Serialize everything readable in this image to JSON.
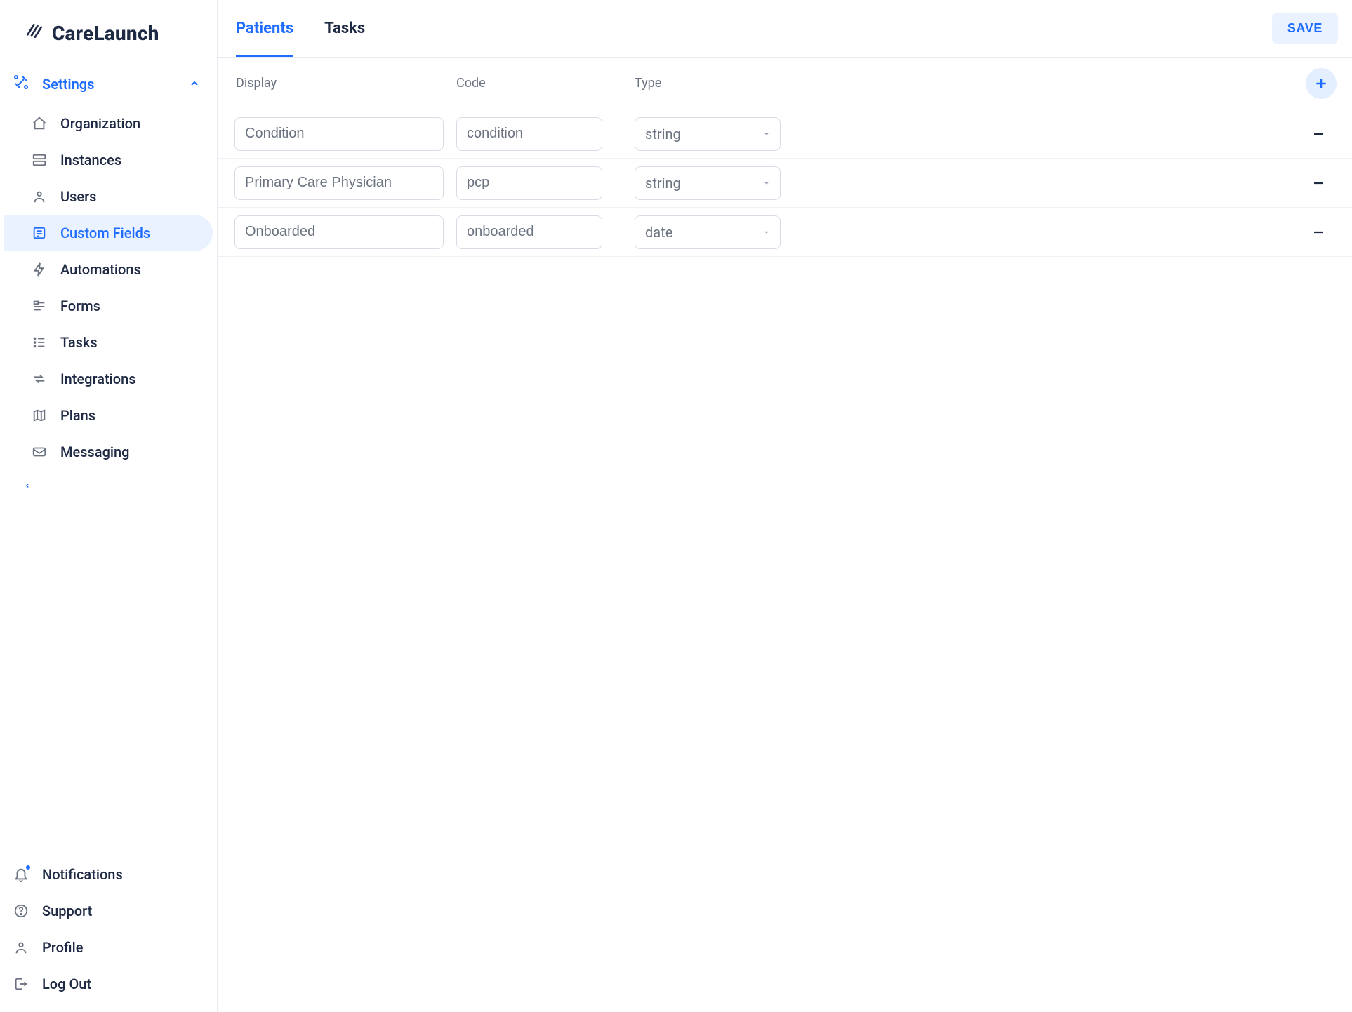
{
  "brand": {
    "name": "CareLaunch"
  },
  "sidebar": {
    "section_label": "Settings",
    "items": [
      {
        "label": "Organization",
        "icon": "home-icon"
      },
      {
        "label": "Instances",
        "icon": "stack-icon"
      },
      {
        "label": "Users",
        "icon": "user-icon"
      },
      {
        "label": "Custom Fields",
        "icon": "list-box-icon",
        "active": true
      },
      {
        "label": "Automations",
        "icon": "bolt-icon"
      },
      {
        "label": "Forms",
        "icon": "form-icon"
      },
      {
        "label": "Tasks",
        "icon": "list-icon"
      },
      {
        "label": "Integrations",
        "icon": "arrows-icon"
      },
      {
        "label": "Plans",
        "icon": "map-icon"
      },
      {
        "label": "Messaging",
        "icon": "mail-icon"
      }
    ]
  },
  "bottom_nav": [
    {
      "label": "Notifications",
      "icon": "bell-icon",
      "badge": true
    },
    {
      "label": "Support",
      "icon": "help-icon"
    },
    {
      "label": "Profile",
      "icon": "user-icon"
    },
    {
      "label": "Log Out",
      "icon": "logout-icon"
    }
  ],
  "topbar": {
    "tabs": [
      {
        "label": "Patients",
        "active": true
      },
      {
        "label": "Tasks",
        "active": false
      }
    ],
    "save_label": "SAVE"
  },
  "columns": {
    "display": "Display",
    "code": "Code",
    "type": "Type"
  },
  "type_options": [
    "string",
    "date"
  ],
  "rows": [
    {
      "display": "Condition",
      "code": "condition",
      "type": "string"
    },
    {
      "display": "Primary Care Physician",
      "code": "pcp",
      "type": "string"
    },
    {
      "display": "Onboarded",
      "code": "onboarded",
      "type": "date"
    }
  ]
}
